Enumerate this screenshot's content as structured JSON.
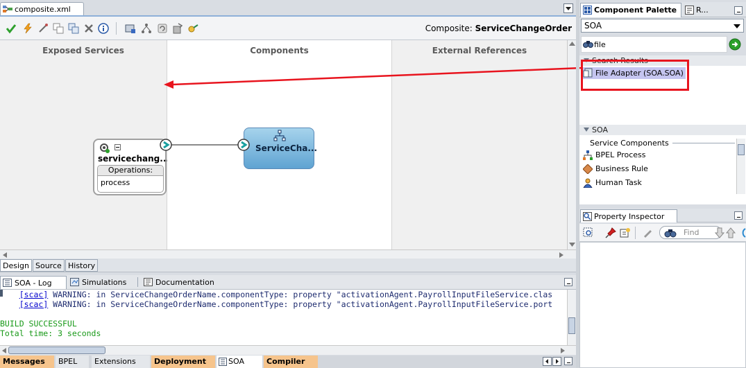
{
  "editor": {
    "file_tab": "composite.xml",
    "composite_prefix": "Composite:",
    "composite_name": "ServiceChangeOrder",
    "toolbar_icons": [
      "validate-icon",
      "lightning-icon",
      "wand-icon",
      "add-icon",
      "copy-icon",
      "delete-icon",
      "info-icon",
      "deploy-icon",
      "tree-icon",
      "refresh-icon",
      "wsdl-icon",
      "brush-icon"
    ]
  },
  "canvas": {
    "columns": [
      "Exposed Services",
      "Components",
      "External References"
    ],
    "service": {
      "name": "servicechang...",
      "operations_label": "Operations:",
      "operation": "process"
    },
    "component": {
      "name": "ServiceCha..."
    }
  },
  "view_tabs": [
    "Design",
    "Source",
    "History"
  ],
  "log_panel": {
    "tabs": [
      "SOA - Log",
      "Simulations",
      "Documentation"
    ],
    "lines": [
      {
        "link": "[scac]",
        "text": " WARNING: in ServiceChangeOrderName.componentType: property \"activationAgent.PayrollInputFileService.clas"
      },
      {
        "link": "[scac]",
        "text": " WARNING: in ServiceChangeOrderName.componentType: property \"activationAgent.PayrollInputFileService.port"
      }
    ],
    "build_status": "BUILD SUCCESSFUL",
    "total_time": "Total time: 3 seconds"
  },
  "status_tabs": [
    "Messages",
    "BPEL",
    "Extensions",
    "Deployment",
    "SOA",
    "Compiler"
  ],
  "component_palette": {
    "title": "Component Palette",
    "second_tab": "R...",
    "dropdown": "SOA",
    "search_value": "file",
    "search_results_header": "Search Results",
    "search_result": "File Adapter (SOA.SOA)",
    "soa_header": "SOA",
    "service_components_header": "Service Components",
    "items": [
      "BPEL Process",
      "Business Rule",
      "Human Task"
    ]
  },
  "property_inspector": {
    "title": "Property Inspector",
    "find_placeholder": "Find"
  },
  "colors": {
    "highlight_border": "#e8141e",
    "arrow": "#e8141e",
    "selected_result": "#c5c5f0",
    "component_fill": "#7fbbe0",
    "build_success": "#1a9a1a"
  }
}
